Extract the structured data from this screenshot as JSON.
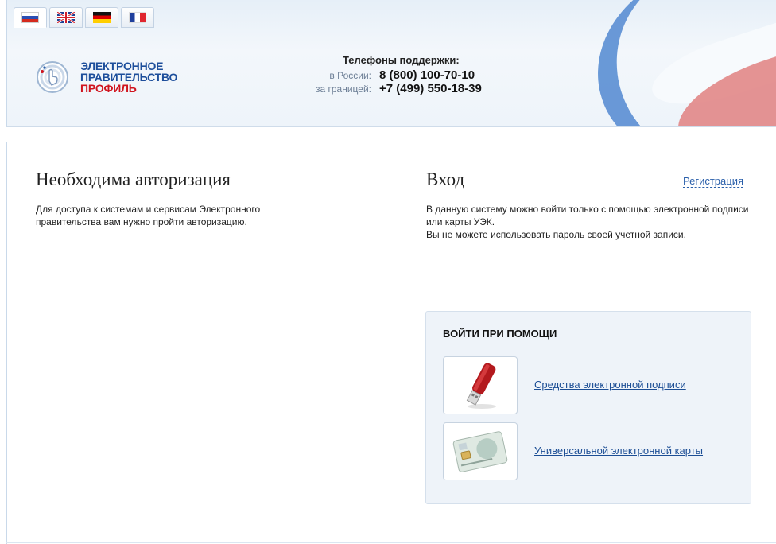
{
  "languages": [
    {
      "code": "ru",
      "icon": "flag-ru-icon",
      "active": true
    },
    {
      "code": "en",
      "icon": "flag-uk-icon",
      "active": false
    },
    {
      "code": "de",
      "icon": "flag-de-icon",
      "active": false
    },
    {
      "code": "fr",
      "icon": "flag-fr-icon",
      "active": false
    }
  ],
  "logo": {
    "line1": "ЭЛЕКТРОННОЕ",
    "line2": "ПРАВИТЕЛЬСТВО",
    "line3": "ПРОФИЛЬ",
    "icon": "hand-touch-logo-icon"
  },
  "support": {
    "title": "Телефоны поддержки:",
    "russia_label": "в России:",
    "russia_phone": "8 (800) 100-70-10",
    "abroad_label": "за границей:",
    "abroad_phone": "+7 (499) 550-18-39"
  },
  "auth": {
    "heading": "Необходима авторизация",
    "description": "Для доступа к системам и сервисам Электронного правительства вам нужно пройти авторизацию."
  },
  "login": {
    "heading": "Вход",
    "register_link": "Регистрация",
    "description_line1": "В данную систему можно войти только с помощью электронной подписи или карты УЭК.",
    "description_line2": "Вы не можете использовать пароль своей учетной записи.",
    "box_title": "ВОЙТИ ПРИ ПОМОЩИ",
    "methods": [
      {
        "label": "Средства электронной подписи",
        "icon": "usb-token-icon"
      },
      {
        "label": "Универсальной электронной карты",
        "icon": "smart-card-icon"
      }
    ]
  },
  "colors": {
    "brand_blue": "#1d4e9b",
    "brand_red": "#d0141e",
    "link": "#1c4e95",
    "panel_bg": "#eef3f9"
  }
}
